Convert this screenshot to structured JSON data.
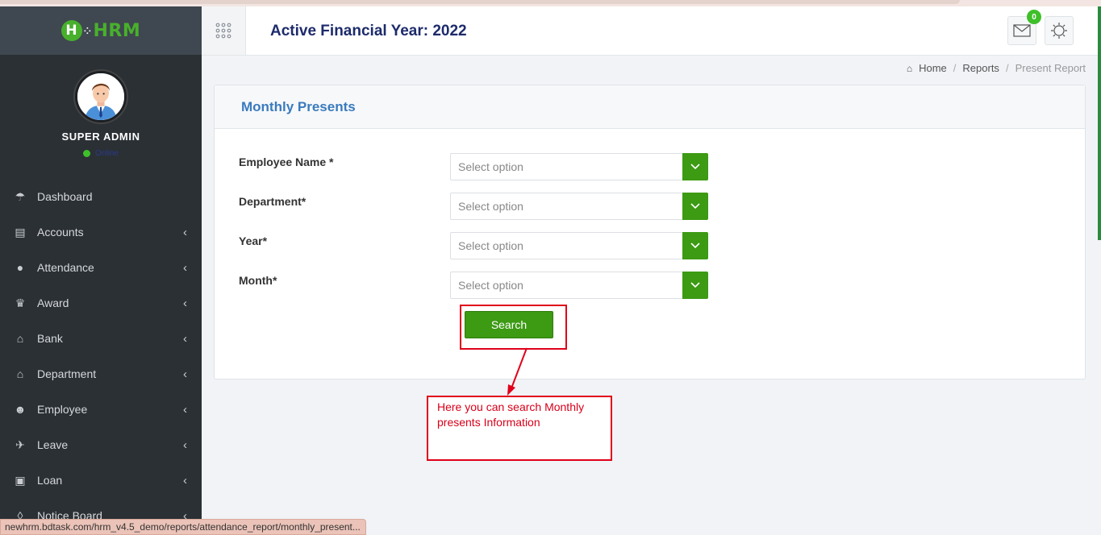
{
  "app": {
    "logo_text": "HRM",
    "logo_letter": "H"
  },
  "profile": {
    "name": "SUPER ADMIN",
    "status": "Online"
  },
  "sidebar": {
    "items": [
      {
        "label": "Dashboard",
        "icon": "dashboard-icon",
        "glyph": "☂",
        "has_children": false
      },
      {
        "label": "Accounts",
        "icon": "briefcase-icon",
        "glyph": "▤",
        "has_children": true
      },
      {
        "label": "Attendance",
        "icon": "user-icon",
        "glyph": "●",
        "has_children": true
      },
      {
        "label": "Award",
        "icon": "trophy-icon",
        "glyph": "♛",
        "has_children": true
      },
      {
        "label": "Bank",
        "icon": "bank-icon",
        "glyph": "⌂",
        "has_children": true
      },
      {
        "label": "Department",
        "icon": "building-icon",
        "glyph": "⌂",
        "has_children": true
      },
      {
        "label": "Employee",
        "icon": "users-icon",
        "glyph": "☻",
        "has_children": true
      },
      {
        "label": "Leave",
        "icon": "plane-icon",
        "glyph": "✈",
        "has_children": true
      },
      {
        "label": "Loan",
        "icon": "money-icon",
        "glyph": "▣",
        "has_children": true
      },
      {
        "label": "Notice Board",
        "icon": "bell-icon",
        "glyph": "◊",
        "has_children": true
      }
    ]
  },
  "header": {
    "title": "Active Financial Year: 2022",
    "mail_badge": "0"
  },
  "breadcrumb": {
    "home": "Home",
    "reports": "Reports",
    "current": "Present Report"
  },
  "panel": {
    "title": "Monthly Presents",
    "fields": [
      {
        "label": "Employee Name *",
        "placeholder": "Select option"
      },
      {
        "label": "Department*",
        "placeholder": "Select option"
      },
      {
        "label": "Year*",
        "placeholder": "Select option"
      },
      {
        "label": "Month*",
        "placeholder": "Select option"
      }
    ],
    "search_label": "Search"
  },
  "annotation": {
    "note": "Here you can search Monthly presents Information"
  },
  "statusbar": {
    "url": "newhrm.bdtask.com/hrm_v4.5_demo/reports/attendance_report/monthly_present..."
  },
  "colors": {
    "accent_green": "#3c9a13",
    "sidebar_bg": "#2b3035",
    "title_blue": "#1d2b6b",
    "annotation_red": "#e0001a"
  }
}
